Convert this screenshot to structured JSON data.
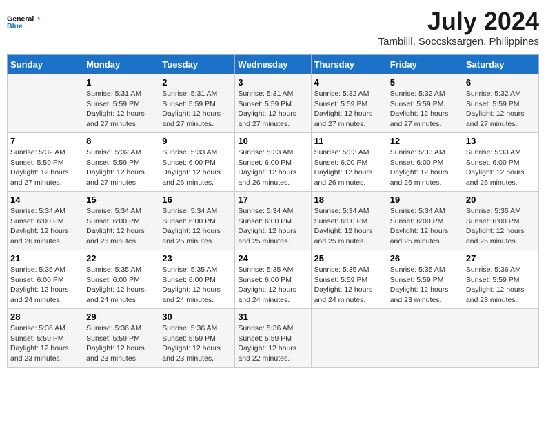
{
  "logo": {
    "line1": "General",
    "line2": "Blue"
  },
  "title": "July 2024",
  "subtitle": "Tambilil, Soccsksargen, Philippines",
  "days_of_week": [
    "Sunday",
    "Monday",
    "Tuesday",
    "Wednesday",
    "Thursday",
    "Friday",
    "Saturday"
  ],
  "weeks": [
    [
      {
        "day": "",
        "detail": ""
      },
      {
        "day": "1",
        "detail": "Sunrise: 5:31 AM\nSunset: 5:59 PM\nDaylight: 12 hours\nand 27 minutes."
      },
      {
        "day": "2",
        "detail": "Sunrise: 5:31 AM\nSunset: 5:59 PM\nDaylight: 12 hours\nand 27 minutes."
      },
      {
        "day": "3",
        "detail": "Sunrise: 5:31 AM\nSunset: 5:59 PM\nDaylight: 12 hours\nand 27 minutes."
      },
      {
        "day": "4",
        "detail": "Sunrise: 5:32 AM\nSunset: 5:59 PM\nDaylight: 12 hours\nand 27 minutes."
      },
      {
        "day": "5",
        "detail": "Sunrise: 5:32 AM\nSunset: 5:59 PM\nDaylight: 12 hours\nand 27 minutes."
      },
      {
        "day": "6",
        "detail": "Sunrise: 5:32 AM\nSunset: 5:59 PM\nDaylight: 12 hours\nand 27 minutes."
      }
    ],
    [
      {
        "day": "7",
        "detail": "Sunrise: 5:32 AM\nSunset: 5:59 PM\nDaylight: 12 hours\nand 27 minutes."
      },
      {
        "day": "8",
        "detail": "Sunrise: 5:32 AM\nSunset: 5:59 PM\nDaylight: 12 hours\nand 27 minutes."
      },
      {
        "day": "9",
        "detail": "Sunrise: 5:33 AM\nSunset: 6:00 PM\nDaylight: 12 hours\nand 26 minutes."
      },
      {
        "day": "10",
        "detail": "Sunrise: 5:33 AM\nSunset: 6:00 PM\nDaylight: 12 hours\nand 26 minutes."
      },
      {
        "day": "11",
        "detail": "Sunrise: 5:33 AM\nSunset: 6:00 PM\nDaylight: 12 hours\nand 26 minutes."
      },
      {
        "day": "12",
        "detail": "Sunrise: 5:33 AM\nSunset: 6:00 PM\nDaylight: 12 hours\nand 26 minutes."
      },
      {
        "day": "13",
        "detail": "Sunrise: 5:33 AM\nSunset: 6:00 PM\nDaylight: 12 hours\nand 26 minutes."
      }
    ],
    [
      {
        "day": "14",
        "detail": "Sunrise: 5:34 AM\nSunset: 6:00 PM\nDaylight: 12 hours\nand 26 minutes."
      },
      {
        "day": "15",
        "detail": "Sunrise: 5:34 AM\nSunset: 6:00 PM\nDaylight: 12 hours\nand 26 minutes."
      },
      {
        "day": "16",
        "detail": "Sunrise: 5:34 AM\nSunset: 6:00 PM\nDaylight: 12 hours\nand 25 minutes."
      },
      {
        "day": "17",
        "detail": "Sunrise: 5:34 AM\nSunset: 6:00 PM\nDaylight: 12 hours\nand 25 minutes."
      },
      {
        "day": "18",
        "detail": "Sunrise: 5:34 AM\nSunset: 6:00 PM\nDaylight: 12 hours\nand 25 minutes."
      },
      {
        "day": "19",
        "detail": "Sunrise: 5:34 AM\nSunset: 6:00 PM\nDaylight: 12 hours\nand 25 minutes."
      },
      {
        "day": "20",
        "detail": "Sunrise: 5:35 AM\nSunset: 6:00 PM\nDaylight: 12 hours\nand 25 minutes."
      }
    ],
    [
      {
        "day": "21",
        "detail": "Sunrise: 5:35 AM\nSunset: 6:00 PM\nDaylight: 12 hours\nand 24 minutes."
      },
      {
        "day": "22",
        "detail": "Sunrise: 5:35 AM\nSunset: 6:00 PM\nDaylight: 12 hours\nand 24 minutes."
      },
      {
        "day": "23",
        "detail": "Sunrise: 5:35 AM\nSunset: 6:00 PM\nDaylight: 12 hours\nand 24 minutes."
      },
      {
        "day": "24",
        "detail": "Sunrise: 5:35 AM\nSunset: 6:00 PM\nDaylight: 12 hours\nand 24 minutes."
      },
      {
        "day": "25",
        "detail": "Sunrise: 5:35 AM\nSunset: 5:59 PM\nDaylight: 12 hours\nand 24 minutes."
      },
      {
        "day": "26",
        "detail": "Sunrise: 5:35 AM\nSunset: 5:59 PM\nDaylight: 12 hours\nand 23 minutes."
      },
      {
        "day": "27",
        "detail": "Sunrise: 5:36 AM\nSunset: 5:59 PM\nDaylight: 12 hours\nand 23 minutes."
      }
    ],
    [
      {
        "day": "28",
        "detail": "Sunrise: 5:36 AM\nSunset: 5:59 PM\nDaylight: 12 hours\nand 23 minutes."
      },
      {
        "day": "29",
        "detail": "Sunrise: 5:36 AM\nSunset: 5:59 PM\nDaylight: 12 hours\nand 23 minutes."
      },
      {
        "day": "30",
        "detail": "Sunrise: 5:36 AM\nSunset: 5:59 PM\nDaylight: 12 hours\nand 23 minutes."
      },
      {
        "day": "31",
        "detail": "Sunrise: 5:36 AM\nSunset: 5:59 PM\nDaylight: 12 hours\nand 22 minutes."
      },
      {
        "day": "",
        "detail": ""
      },
      {
        "day": "",
        "detail": ""
      },
      {
        "day": "",
        "detail": ""
      }
    ]
  ]
}
